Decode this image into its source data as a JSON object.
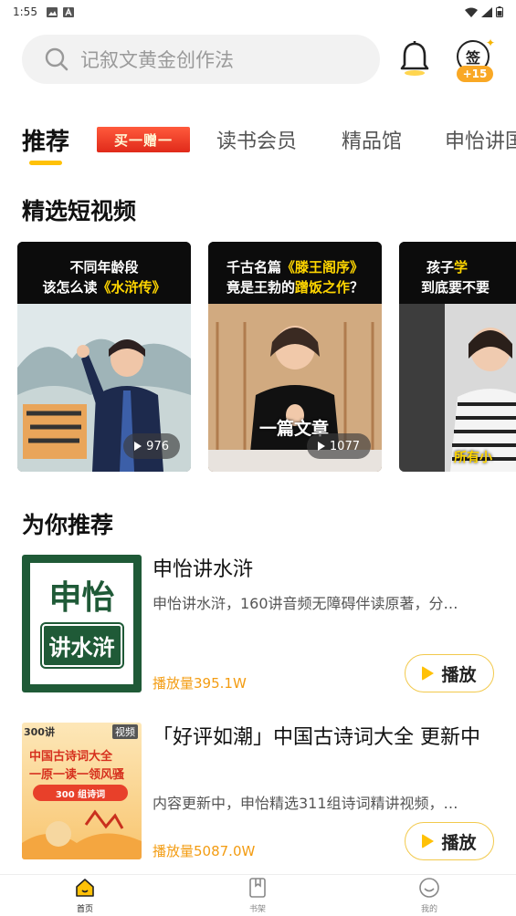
{
  "status_bar": {
    "time": "1:55"
  },
  "search": {
    "placeholder": "记叙文黄金创作法"
  },
  "signin": {
    "label": "签",
    "bonus": "+15"
  },
  "tabs": [
    {
      "label": "推荐",
      "active": true
    },
    {
      "label": "读书会员"
    },
    {
      "label": "精品馆"
    },
    {
      "label": "申怡讲国"
    }
  ],
  "promo_tag": "买一赠一",
  "short_videos": {
    "title": "精选短视频",
    "items": [
      {
        "line1": "不同年龄段",
        "line2_pre": "该怎么读",
        "line2_hl": "《水浒传》",
        "views": "976"
      },
      {
        "line1_pre": "千古名篇",
        "line1_hl": "《滕王阁序》",
        "line2_pre": "竟是王勃的",
        "line2_hl": "蹭饭之作",
        "line2_post": "？",
        "overlay": "一篇文章",
        "views": "1077"
      },
      {
        "line1_pre": "孩子",
        "line1_hl": "学",
        "line2": "到底要不要",
        "overlay": "所有小"
      }
    ]
  },
  "recommend": {
    "title": "为你推荐",
    "items": [
      {
        "title": "申怡讲水浒",
        "desc": "申怡讲水浒，160讲音频无障碍伴读原著，分…",
        "plays": "播放量395.1W",
        "button": "播放",
        "cover_line1": "申怡",
        "cover_line2": "讲水浒"
      },
      {
        "title": "「好评如潮」中国古诗词大全 更新中",
        "desc": "内容更新中，申怡精选311组诗词精讲视频，…",
        "plays": "播放量5087.0W",
        "button": "播放",
        "cover_badge_left": "300讲",
        "cover_badge_right": "视频",
        "cover_line1": "中国古诗词大全",
        "cover_line2": "一原一读一领风骚",
        "cover_line3": "300 组诗词"
      }
    ]
  },
  "bottom_nav": [
    {
      "label": "首页",
      "active": true
    },
    {
      "label": "书架"
    },
    {
      "label": "我的"
    }
  ]
}
